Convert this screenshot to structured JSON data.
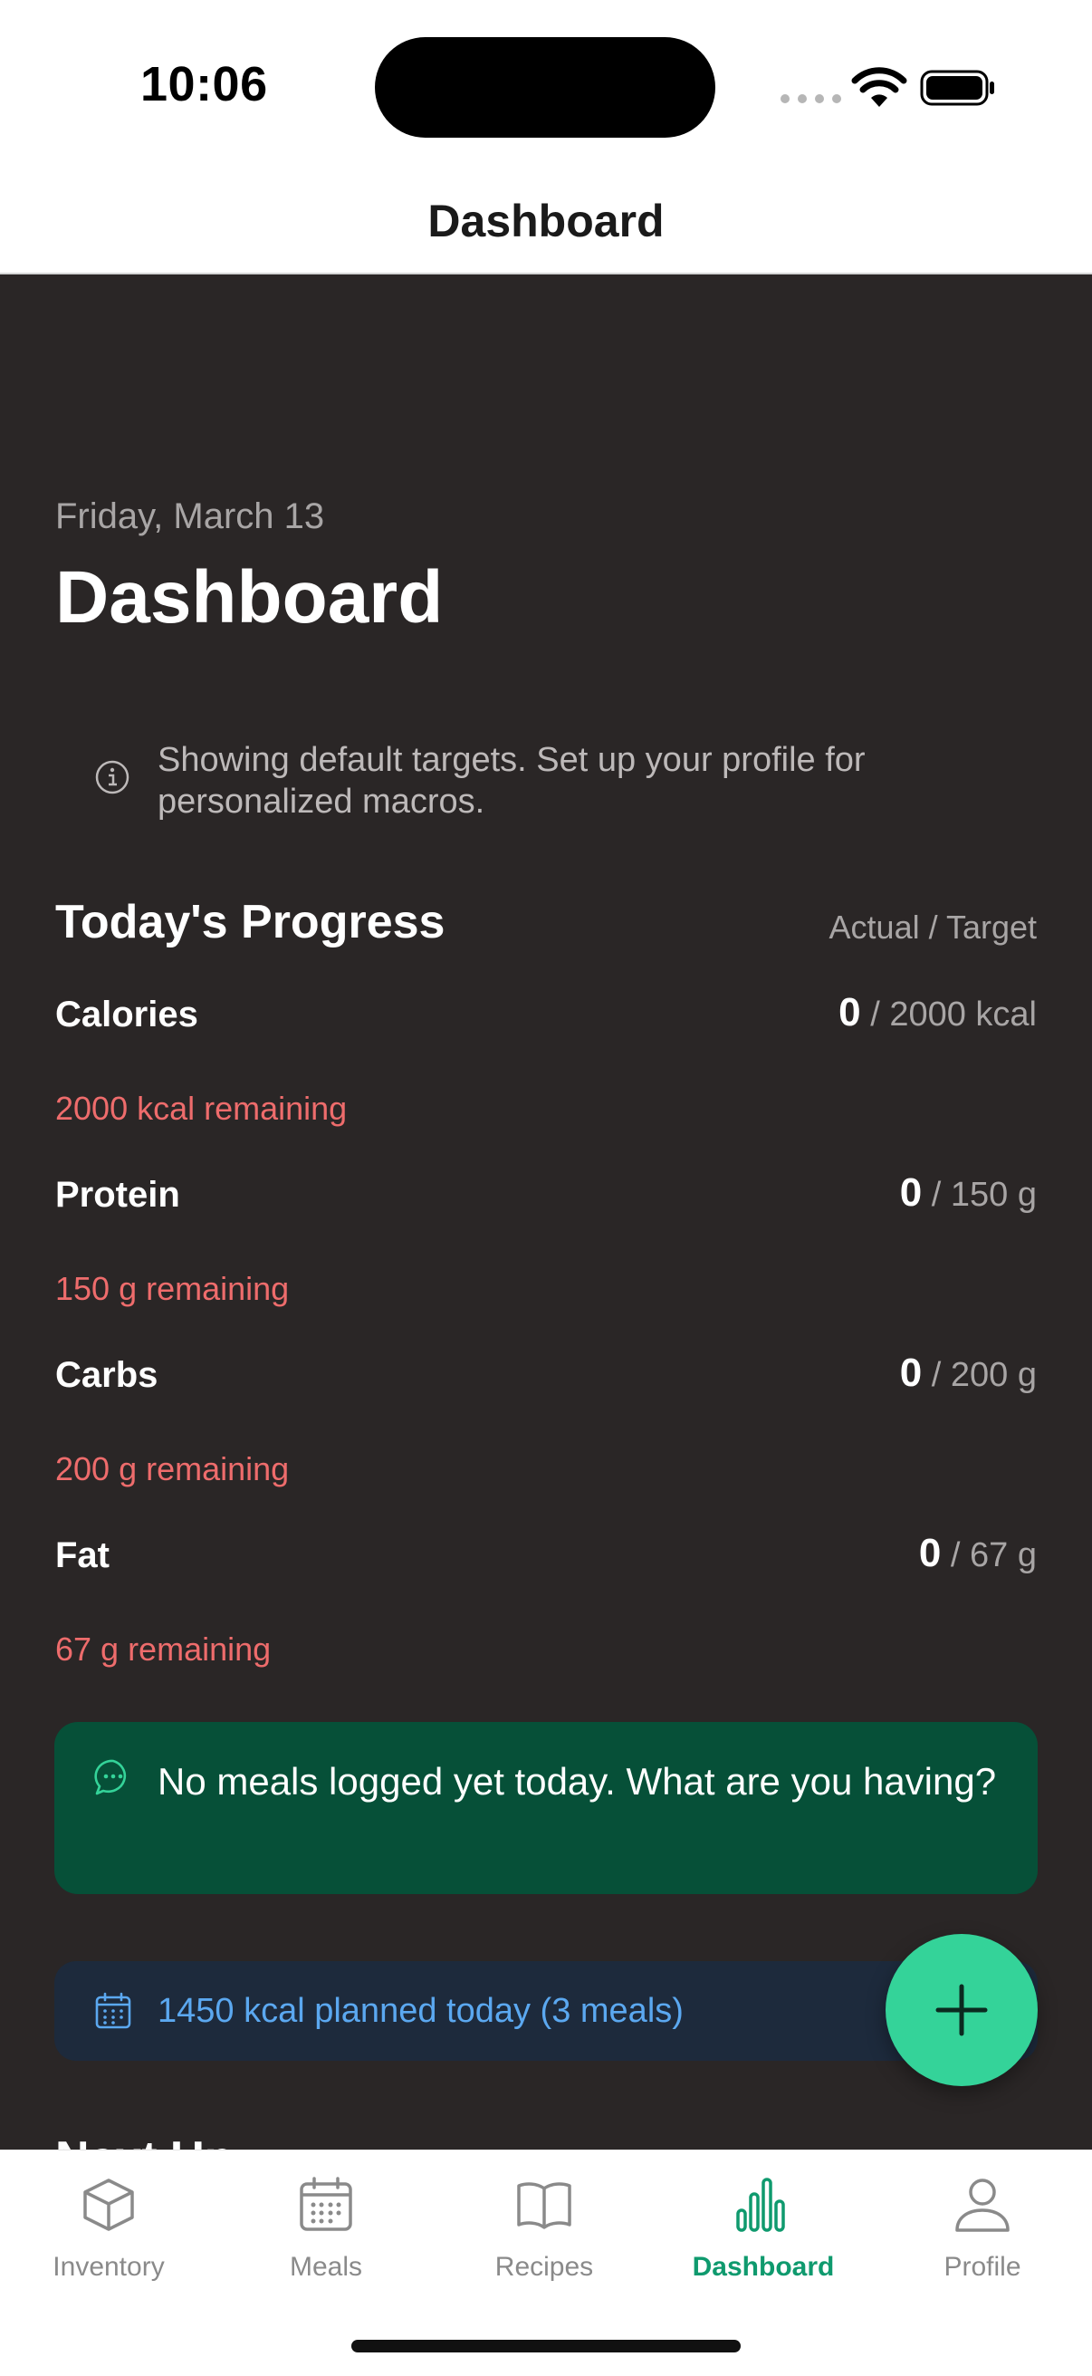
{
  "status_bar": {
    "time": "10:06"
  },
  "header": {
    "title": "Dashboard"
  },
  "page": {
    "date": "Friday, March 13",
    "title": "Dashboard",
    "info_notice": "Showing default targets. Set up your profile for personalized macros."
  },
  "progress": {
    "title": "Today's Progress",
    "meta": "Actual / Target",
    "macros": [
      {
        "label": "Calories",
        "actual": "0",
        "target": "/ 2000 kcal",
        "remaining": "2000 kcal remaining"
      },
      {
        "label": "Protein",
        "actual": "0",
        "target": "/ 150 g",
        "remaining": "150 g remaining"
      },
      {
        "label": "Carbs",
        "actual": "0",
        "target": "/ 200 g",
        "remaining": "200 g remaining"
      },
      {
        "label": "Fat",
        "actual": "0",
        "target": "/ 67 g",
        "remaining": "67 g remaining"
      }
    ]
  },
  "meal_prompt": {
    "text": "No meals logged yet today. What are you having?",
    "icon": "chat-bubble-icon"
  },
  "planned": {
    "text": "1450 kcal planned today (3 meals)",
    "icon": "calendar-icon"
  },
  "next_up": {
    "title": "Next Up"
  },
  "tab_bar": {
    "active": "Dashboard",
    "items": [
      {
        "label": "Inventory",
        "icon": "cube-icon"
      },
      {
        "label": "Meals",
        "icon": "calendar-icon"
      },
      {
        "label": "Recipes",
        "icon": "book-icon"
      },
      {
        "label": "Dashboard",
        "icon": "bar-chart-icon"
      },
      {
        "label": "Profile",
        "icon": "person-icon"
      }
    ]
  },
  "colors": {
    "background": "#2a2626",
    "accent_green": "#34d399",
    "remaining_red": "#ee6c6c",
    "planned_blue": "#5ba8f0",
    "prompt_card": "#065038",
    "active_tab": "#0f9a6e"
  }
}
